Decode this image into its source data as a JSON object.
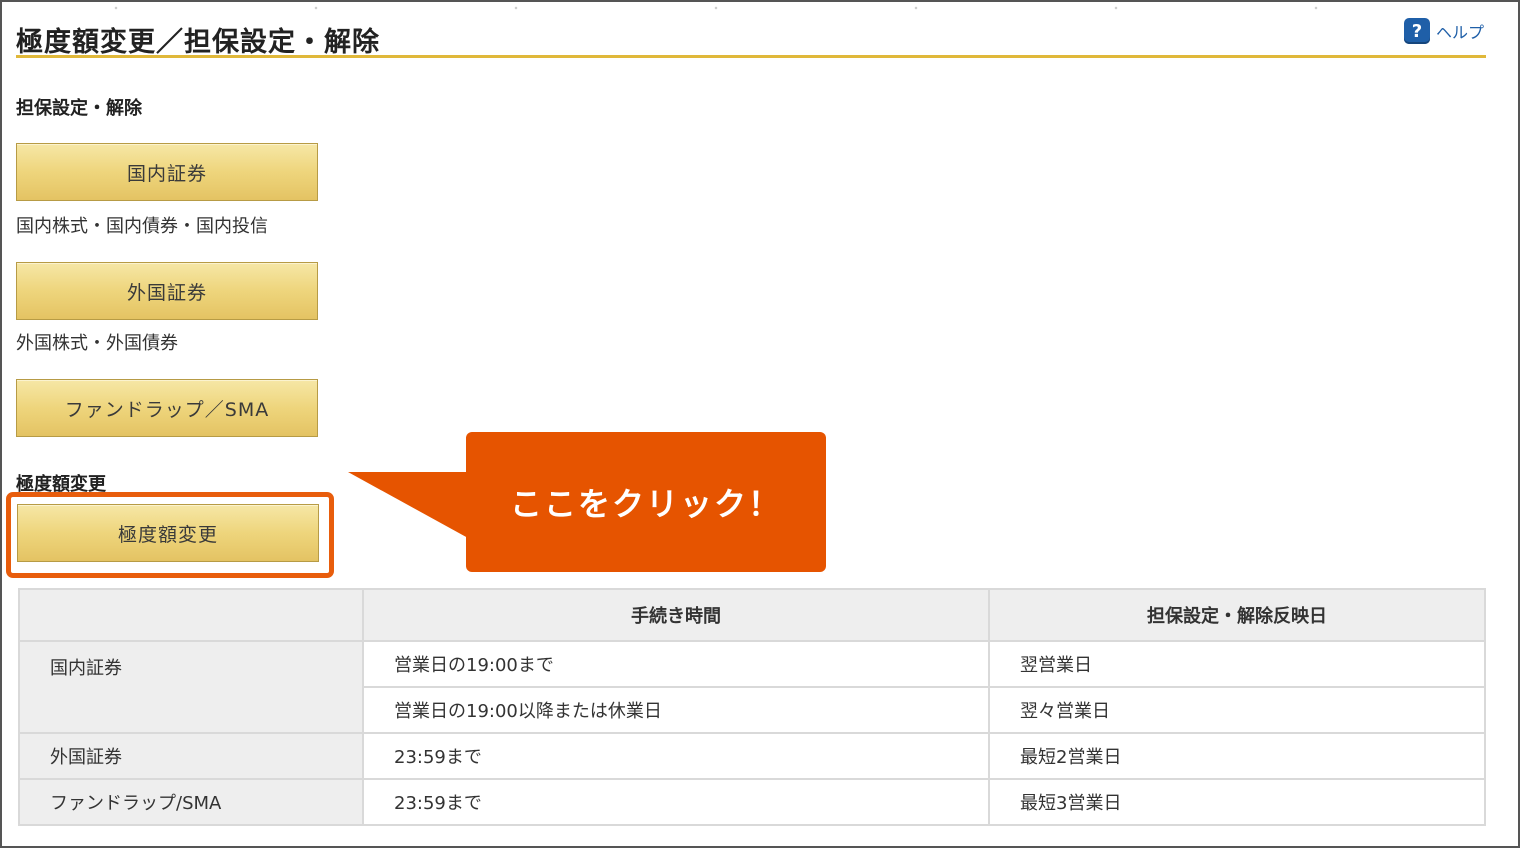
{
  "header": {
    "title": "極度額変更／担保設定・解除",
    "help_label": "ヘルプ",
    "help_icon": "help-icon"
  },
  "collateral_section": {
    "label": "担保設定・解除",
    "buttons": [
      {
        "label": "国内証券",
        "description": "国内株式・国内債券・国内投信"
      },
      {
        "label": "外国証券",
        "description": "外国株式・外国債券"
      },
      {
        "label": "ファンドラップ／SMA",
        "description": ""
      }
    ]
  },
  "limit_section": {
    "label": "極度額変更",
    "button_label": "極度額変更"
  },
  "callout": {
    "text": "ここをクリック！",
    "color": "#e65400"
  },
  "schedule_table": {
    "headers": [
      "",
      "手続き時間",
      "担保設定・解除反映日"
    ],
    "rows": [
      {
        "category": "国内証券",
        "time": "営業日の19:00まで",
        "reflect": "翌営業日"
      },
      {
        "category": "",
        "time": "営業日の19:00以降または休業日",
        "reflect": "翌々営業日"
      },
      {
        "category": "外国証券",
        "time": "23:59まで",
        "reflect": "最短2営業日"
      },
      {
        "category": "ファンドラップ/SMA",
        "time": "23:59まで",
        "reflect": "最短3営業日"
      }
    ]
  },
  "colors": {
    "accent_gold": "#e0b83a",
    "highlight_orange": "#e85d0c",
    "link_blue": "#1f5fa8"
  }
}
